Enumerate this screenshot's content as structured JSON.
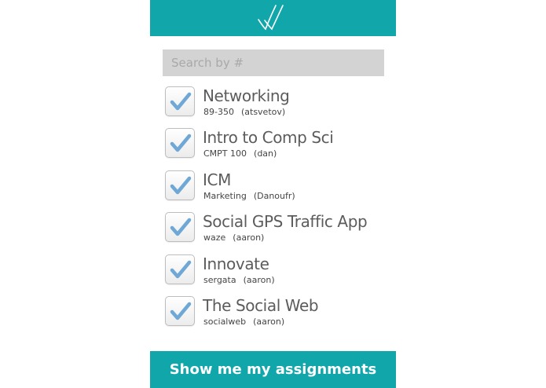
{
  "header": {
    "logo_icon": "double-checkmark-logo-icon",
    "bar_color": "#10a6aa"
  },
  "search": {
    "placeholder": "Search by #",
    "value": ""
  },
  "courses": [
    {
      "title": "Networking",
      "code": "89-350",
      "owner": "(atsvetov)",
      "checked": true
    },
    {
      "title": "Intro to Comp Sci",
      "code": "CMPT 100",
      "owner": "(dan)",
      "checked": true
    },
    {
      "title": "ICM",
      "code": "Marketing",
      "owner": "(Danoufr)",
      "checked": true
    },
    {
      "title": "Social GPS Traffic App",
      "code": "waze",
      "owner": "(aaron)",
      "checked": true
    },
    {
      "title": "Innovate",
      "code": "sergata",
      "owner": "(aaron)",
      "checked": true
    },
    {
      "title": "The Social Web",
      "code": "socialweb",
      "owner": "(aaron)",
      "checked": true
    }
  ],
  "footer": {
    "button_label": "Show me my assignments"
  },
  "colors": {
    "accent": "#10a6aa",
    "check": "#6fa8d6"
  }
}
